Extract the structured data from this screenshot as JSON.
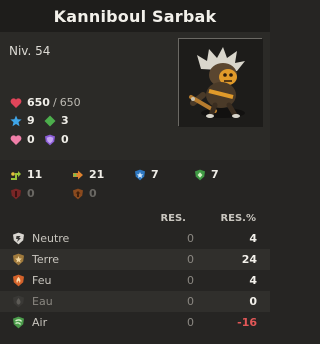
{
  "header": {
    "title": "Kanniboul Sarbak"
  },
  "profile": {
    "level": "Niv. 54",
    "hp_current": "650",
    "hp_sep": "/",
    "hp_max": "650",
    "ap": "9",
    "mp": "3",
    "shield": "0",
    "erosion": "0"
  },
  "secondary": {
    "row1": [
      {
        "icon": "dodge-ap-icon",
        "value": "11"
      },
      {
        "icon": "dodge-mp-icon",
        "value": "21"
      },
      {
        "icon": "ap-resist-shield-icon",
        "value": "7"
      },
      {
        "icon": "mp-resist-shield-icon",
        "value": "7"
      }
    ],
    "row2": [
      {
        "icon": "red-shield-icon",
        "value": "0"
      },
      {
        "icon": "orange-shield-icon",
        "value": "0"
      }
    ]
  },
  "resistances": {
    "headers": {
      "res": "RES.",
      "pct": "RES.%"
    },
    "rows": [
      {
        "name": "Neutre",
        "icon": "neutral-element-icon",
        "res": "0",
        "pct": "4"
      },
      {
        "name": "Terre",
        "icon": "earth-element-icon",
        "res": "0",
        "pct": "24"
      },
      {
        "name": "Feu",
        "icon": "fire-element-icon",
        "res": "0",
        "pct": "4"
      },
      {
        "name": "Eau",
        "icon": "water-element-icon",
        "res": "0",
        "pct": "0"
      },
      {
        "name": "Air",
        "icon": "air-element-icon",
        "res": "0",
        "pct": "-16"
      }
    ]
  },
  "colors": {
    "hp": "#e0455a",
    "ap": "#3fa5e8",
    "mp": "#4cae4c",
    "negative": "#e25757",
    "background": "#262523"
  }
}
